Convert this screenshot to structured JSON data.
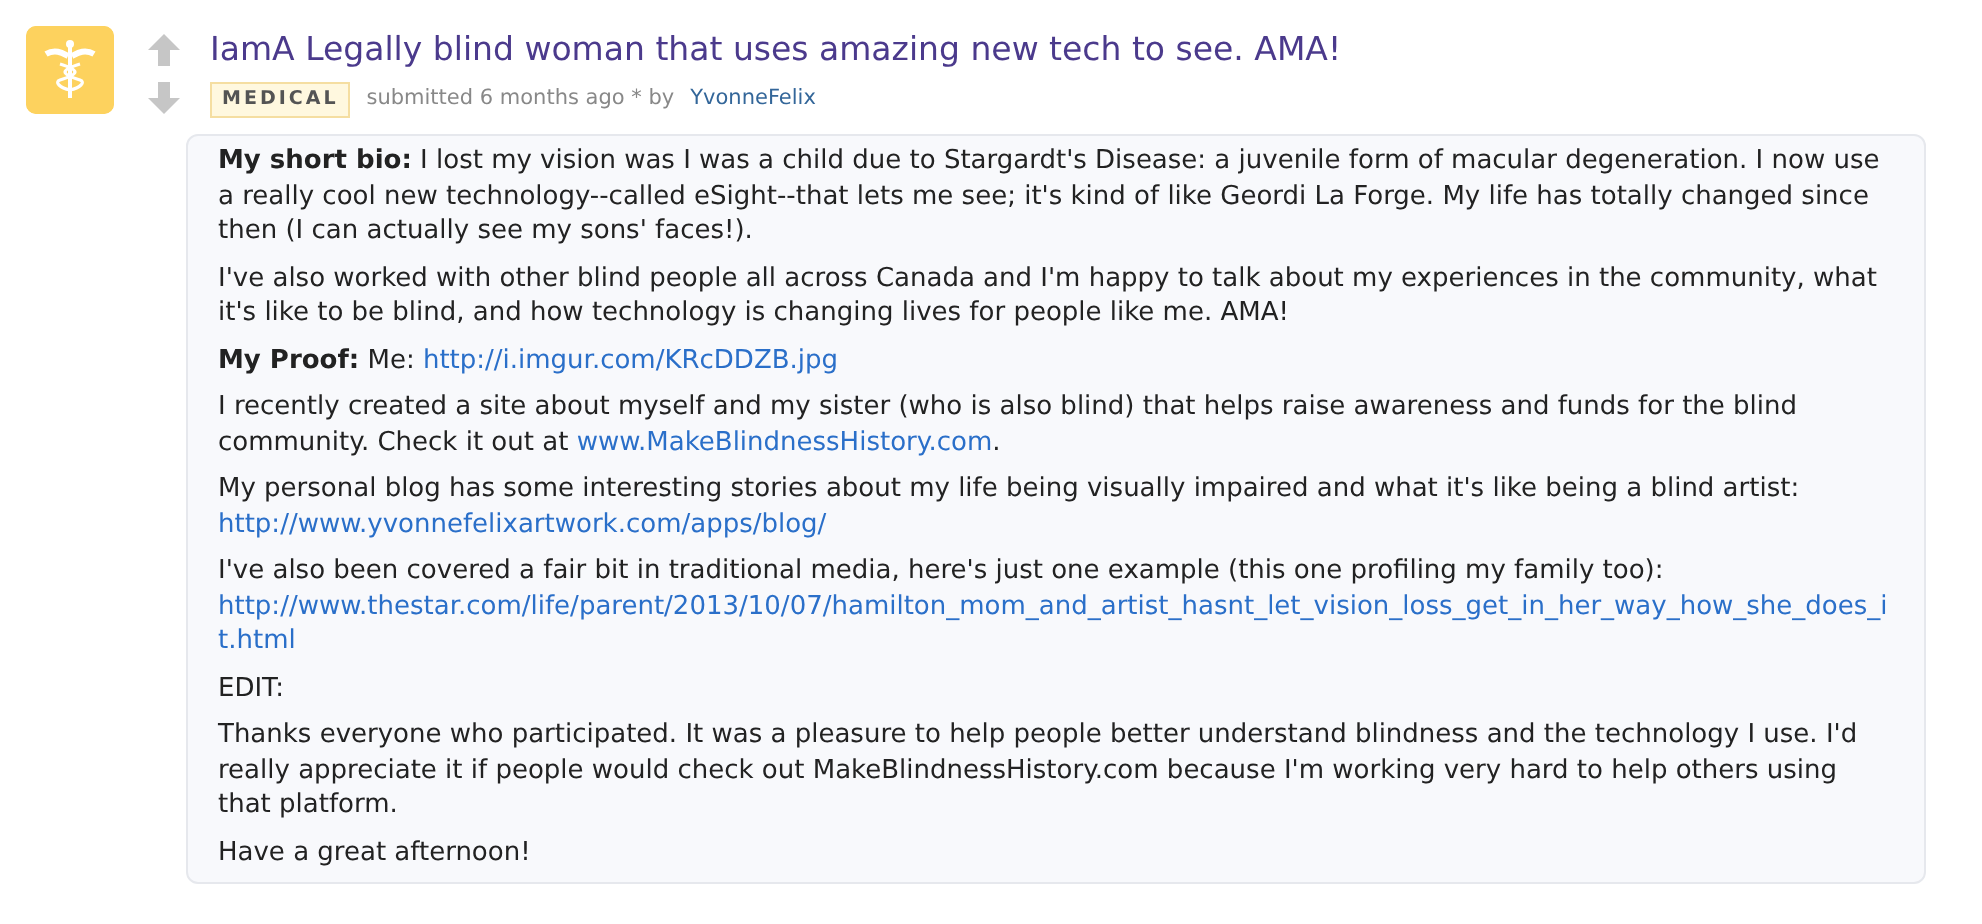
{
  "post": {
    "title": "IamA Legally blind woman that uses amazing new tech to see. AMA!",
    "flair": "MEDICAL",
    "submitted": "submitted 6 months ago * by",
    "author": "YvonneFelix",
    "paragraphs": [
      {
        "parts": [
          {
            "kind": "text",
            "text": "**My short bio:** I lost my vision was I was a child due to Stargardt's Disease: a juvenile form of macular degeneration. I now use a really cool new technology--called eSight--that lets me see; it's kind of like Geordi La Forge. My life has totally changed since then (I can actually see my sons' faces!)."
          }
        ]
      },
      {
        "parts": [
          {
            "kind": "text",
            "text": "I've also worked with other blind people all across Canada and I'm happy to talk about my experiences in the community, what it's like to be blind, and how technology is changing lives for people like me. AMA!"
          }
        ]
      },
      {
        "parts": [
          {
            "kind": "text",
            "text": "**My Proof:** Me: "
          },
          {
            "kind": "link",
            "text": "http://i.imgur.com/KRcDDZB.jpg"
          }
        ]
      },
      {
        "parts": [
          {
            "kind": "text",
            "text": "I recently created a site about myself and my sister (who is also blind) that helps raise awareness and funds for the blind community. Check it out at "
          },
          {
            "kind": "link",
            "text": "www.MakeBlindnessHistory.com"
          },
          {
            "kind": "text",
            "text": "."
          }
        ]
      },
      {
        "parts": [
          {
            "kind": "text",
            "text": "My personal blog has some interesting stories about my life being visually impaired and what it's like being a blind artist: "
          },
          {
            "kind": "link",
            "text": "http://www.yvonnefelixartwork.com/apps/blog/"
          }
        ]
      },
      {
        "parts": [
          {
            "kind": "text",
            "text": "I've also been covered a fair bit in traditional media, here's just one example (this one profiling my family too):"
          },
          {
            "kind": "blocklink",
            "text": "http://www.thestar.com/life/parent/2013/10/07/hamilton_mom_and_artist_hasnt_let_vision_loss_get_in_her_way_how_she_does_it.html"
          }
        ]
      },
      {
        "parts": [
          {
            "kind": "text",
            "text": "EDIT:"
          }
        ]
      },
      {
        "parts": [
          {
            "kind": "text",
            "text": "Thanks everyone who participated. It was a pleasure to help people better understand blindness and the technology I use. I'd really appreciate it if people would check out MakeBlindnessHistory.com because I'm working very hard to help others using that platform."
          }
        ]
      },
      {
        "parts": [
          {
            "kind": "text",
            "text": "Have a great afternoon!"
          }
        ]
      }
    ]
  }
}
